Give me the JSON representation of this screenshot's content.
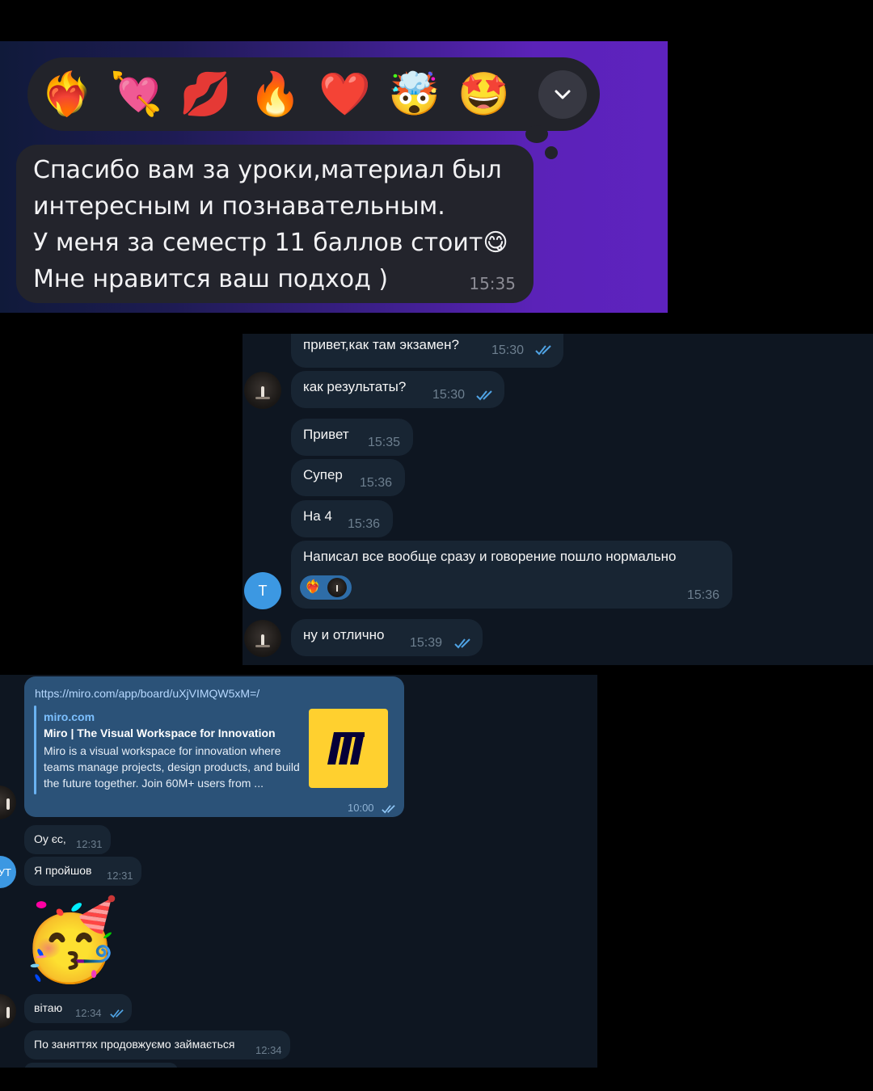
{
  "shot1": {
    "reactions": [
      "❤️‍🔥",
      "💘",
      "💋",
      "🔥",
      "❤️",
      "🤯",
      "🤩"
    ],
    "expand_icon": "chevron-down-icon",
    "message_lines": [
      "Спасибо вам за уроки,материал был",
      "интересным и познавательным.",
      "У меня за семестр 11 баллов стоит",
      "Мне нравится ваш подход )"
    ],
    "message_emoji": "😋",
    "time": "15:35"
  },
  "shot2": {
    "messages": [
      {
        "text": "привет,как там экзамен?",
        "time": "15:30"
      },
      {
        "text": "как результаты?",
        "time": "15:30"
      },
      {
        "text": "Привет",
        "time": "15:35"
      },
      {
        "text": "Супер",
        "time": "15:36"
      },
      {
        "text": "На 4",
        "time": "15:36"
      },
      {
        "text": "Написал все вообще сразу и говорение пошло нормально",
        "time": "15:36",
        "reaction": "❤️‍🔥"
      },
      {
        "text": "ну и отлично",
        "time": "15:39"
      }
    ],
    "avatar_initial": "Т"
  },
  "shot3": {
    "link": {
      "url": "https://miro.com/app/board/uXjVIMQW5xM=/",
      "site": "miro.com",
      "title": "Miro | The Visual Workspace for Innovation",
      "description": "Miro is a visual workspace for innovation where teams manage projects, design products, and build the future together. Join 60M+ users from ...",
      "time": "10:00"
    },
    "messages": [
      {
        "text": "Оу єс,",
        "time": "12:31"
      },
      {
        "text": "Я пройшов",
        "time": "12:31"
      },
      {
        "text": "вітаю",
        "time": "12:34"
      },
      {
        "text": "По заняттях продовжуємо займається",
        "time": "12:34"
      }
    ],
    "sticker": "🥳",
    "avatar_initial": "УТ"
  }
}
